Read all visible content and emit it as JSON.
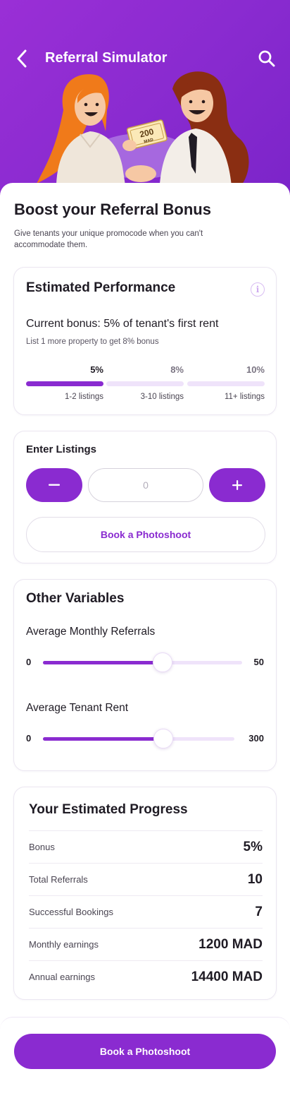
{
  "header": {
    "title": "Referral Simulator",
    "back_icon": "back-arrow-icon",
    "search_icon": "search-icon"
  },
  "hero": {
    "bill_amount": "200",
    "bill_currency": "MAD"
  },
  "intro": {
    "title": "Boost your Referral Bonus",
    "subtitle": "Give tenants your unique promocode when you can't accommodate them."
  },
  "performance": {
    "title": "Estimated Performance",
    "current": "Current bonus: 5% of tenant's first rent",
    "hint": "List 1 more property to get 8% bonus",
    "tiers": [
      {
        "pct": "5%",
        "label": "1-2 listings",
        "active": true
      },
      {
        "pct": "8%",
        "label": "3-10 listings",
        "active": false
      },
      {
        "pct": "10%",
        "label": "11+ listings",
        "active": false
      }
    ]
  },
  "listings": {
    "title": "Enter Listings",
    "decrement": "−",
    "increment": "+",
    "value": "0",
    "photoshoot_label": "Book a Photoshoot"
  },
  "variables": {
    "title": "Other Variables",
    "referrals": {
      "label": "Average Monthly Referrals",
      "min": "0",
      "max": "50",
      "fraction": 0.6
    },
    "rent": {
      "label": "Average Tenant Rent",
      "min": "0",
      "max": "300",
      "fraction": 0.63
    }
  },
  "progress": {
    "title": "Your Estimated Progress",
    "rows": [
      {
        "label": "Bonus",
        "value": "5%"
      },
      {
        "label": "Total Referrals",
        "value": "10"
      },
      {
        "label": "Successful Bookings",
        "value": "7"
      },
      {
        "label": "Monthly earnings",
        "value": "1200 MAD"
      },
      {
        "label": "Annual earnings",
        "value": "14400 MAD"
      }
    ]
  },
  "footer": {
    "cta_label": "Book a Photoshoot"
  },
  "colors": {
    "accent": "#8a2bd0",
    "accent_light": "#efe3fa",
    "text": "#1f1b24"
  }
}
